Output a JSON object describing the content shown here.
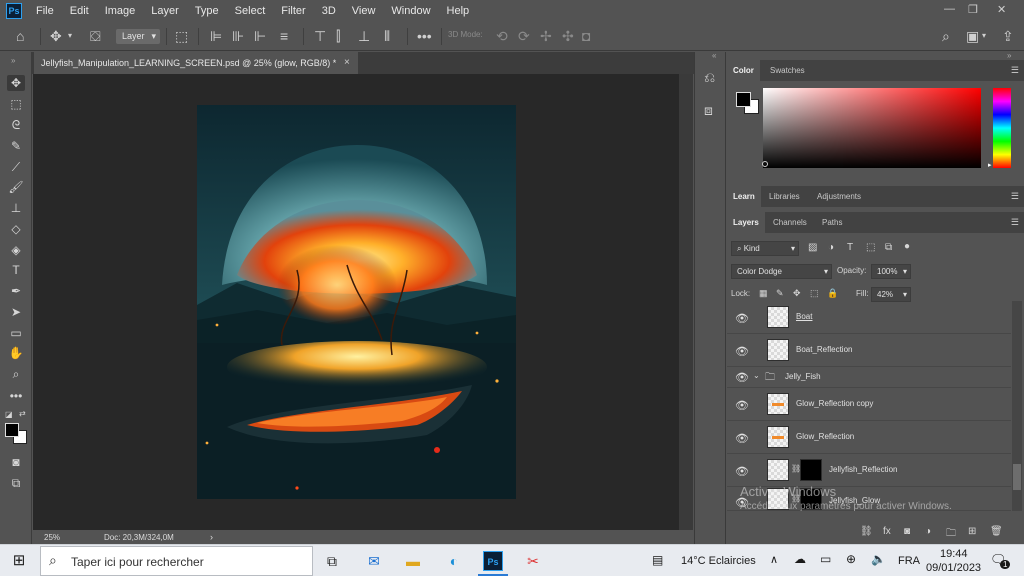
{
  "menubar": {
    "logo": "Ps",
    "items": [
      "File",
      "Edit",
      "Image",
      "Layer",
      "Type",
      "Select",
      "Filter",
      "3D",
      "View",
      "Window",
      "Help"
    ]
  },
  "options": {
    "layer_select": "Layer",
    "mode_3d_label": "3D Mode:"
  },
  "document": {
    "tab_title": "Jellyfish_Manipulation_LEARNING_SCREEN.psd @ 25% (glow, RGB/8) *",
    "zoom": "25%",
    "doc_info": "Doc: 20,3M/324,0M"
  },
  "color_panel": {
    "tabs": [
      "Color",
      "Swatches"
    ],
    "hue_indicator": "▸"
  },
  "learn_panel": {
    "tabs": [
      "Learn",
      "Libraries",
      "Adjustments"
    ]
  },
  "layers_panel": {
    "tabs": [
      "Layers",
      "Channels",
      "Paths"
    ],
    "filter_kind": "Kind",
    "blend_mode": "Color Dodge",
    "opacity_label": "Opacity:",
    "opacity_value": "100%",
    "lock_label": "Lock:",
    "fill_label": "Fill:",
    "fill_value": "42%",
    "layers": [
      {
        "name": "Boat",
        "thumb": "boat"
      },
      {
        "name": "Boat_Reflection",
        "thumb": "plain"
      },
      {
        "name": "Jelly_Fish",
        "thumb": "folder"
      },
      {
        "name": "Glow_Reflection copy",
        "thumb": "glow"
      },
      {
        "name": "Glow_Reflection",
        "thumb": "glow"
      },
      {
        "name": "Jellyfish_Reflection",
        "thumb": "masked"
      },
      {
        "name": "Jellyfish_Glow",
        "thumb": "masked"
      }
    ]
  },
  "watermark": {
    "line1": "Activer Windows",
    "line2": "Accédez aux paramètres pour activer Windows."
  },
  "taskbar": {
    "search_placeholder": "Taper ici pour rechercher",
    "weather": "14°C  Eclaircies",
    "language": "FRA",
    "time": "19:44",
    "date": "09/01/2023",
    "notification_count": "1"
  }
}
